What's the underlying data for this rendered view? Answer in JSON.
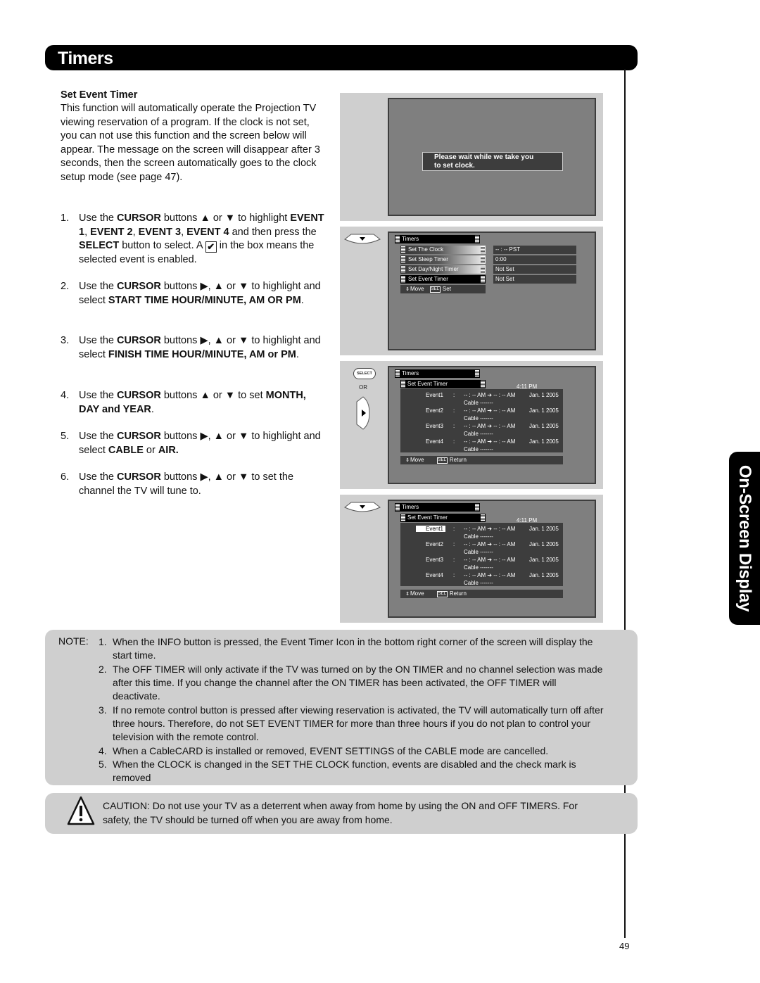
{
  "header": {
    "title": "Timers"
  },
  "side_tab": {
    "label": "On-Screen Display"
  },
  "section": {
    "heading": "Set Event Timer",
    "intro": "This function will automatically operate the Projection TV viewing reservation of a program. If the clock is not set, you can not use this function and the screen below will appear. The message on the screen will disappear after 3 seconds, then the screen automatically goes to the clock setup mode (see page 47)."
  },
  "steps": [
    {
      "num": "1.",
      "parts": [
        {
          "t": "Use the "
        },
        {
          "b": "CURSOR"
        },
        {
          "t": " buttons ▲ or ▼ to highlight "
        },
        {
          "b": "EVENT 1"
        },
        {
          "t": ", "
        },
        {
          "b": "EVENT 2"
        },
        {
          "t": ", "
        },
        {
          "b": "EVENT 3"
        },
        {
          "t": ", "
        },
        {
          "b": "EVENT 4"
        },
        {
          "t": " and then press the "
        },
        {
          "b": "SELECT"
        },
        {
          "t": " button to select.  A "
        },
        {
          "check": "✔"
        },
        {
          "t": " in the box means the selected event is enabled."
        }
      ]
    },
    {
      "num": "2.",
      "parts": [
        {
          "t": "Use the "
        },
        {
          "b": "CURSOR"
        },
        {
          "t": " buttons ▶, ▲ or ▼ to highlight and select "
        },
        {
          "b": "START TIME HOUR/MINUTE, AM OR PM"
        },
        {
          "t": "."
        }
      ]
    },
    {
      "num": "3.",
      "parts": [
        {
          "t": "Use the "
        },
        {
          "b": "CURSOR"
        },
        {
          "t": " buttons ▶, ▲ or ▼ to highlight and select "
        },
        {
          "b": "FINISH TIME HOUR/MINUTE, AM or PM"
        },
        {
          "t": "."
        }
      ]
    },
    {
      "num": "4.",
      "parts": [
        {
          "t": "Use the "
        },
        {
          "b": "CURSOR"
        },
        {
          "t": " buttons ▲ or ▼ to set "
        },
        {
          "b": "MONTH, DAY and YEAR"
        },
        {
          "t": "."
        }
      ]
    },
    {
      "num": "5.",
      "parts": [
        {
          "t": "Use the "
        },
        {
          "b": "CURSOR"
        },
        {
          "t": " buttons ▶, ▲ or ▼ to highlight and select "
        },
        {
          "b": "CABLE"
        },
        {
          "t": " or "
        },
        {
          "b": "AIR."
        }
      ]
    },
    {
      "num": "6.",
      "parts": [
        {
          "t": "Use the "
        },
        {
          "b": "CURSOR"
        },
        {
          "t": " buttons ▶, ▲ or ▼ to set the channel the TV will tune to."
        }
      ]
    }
  ],
  "screen1": {
    "message_line1": "Please wait while we take you",
    "message_line2": "to set clock."
  },
  "screen2": {
    "remote_icon": "cursor-down-button",
    "menu_title": "Timers",
    "items": [
      {
        "label": "Set The Clock",
        "value": "-- : --  PST"
      },
      {
        "label": "Set Sleep Timer",
        "value": "0:00"
      },
      {
        "label": "Set Day/Night Timer",
        "value": "Not Set"
      },
      {
        "label": "Set Event Timer",
        "value": "Not Set"
      }
    ],
    "hint_move": "Move",
    "hint_sel_key": "SEL",
    "hint_set": "Set"
  },
  "screen3": {
    "remote_select": "SELECT",
    "remote_or": "OR",
    "remote_icon": "cursor-right-button",
    "menu_title": "Timers",
    "submenu_title": "Set Event Timer",
    "clock": "4:11 PM",
    "events": [
      {
        "name": "Event1",
        "colon": ":",
        "time": "-- : -- AM  ➔ -- : -- AM",
        "date": "Jan. 1 2005",
        "source": "Cable   -------"
      },
      {
        "name": "Event2",
        "colon": ":",
        "time": "-- : -- AM  ➔ -- : -- AM",
        "date": "Jan. 1 2005",
        "source": "Cable   -------"
      },
      {
        "name": "Event3",
        "colon": ":",
        "time": "-- : -- AM  ➔ -- : -- AM",
        "date": "Jan. 1 2005",
        "source": "Cable   -------"
      },
      {
        "name": "Event4",
        "colon": ":",
        "time": "-- : -- AM  ➔ -- : -- AM",
        "date": "Jan. 1 2005",
        "source": "Cable   -------"
      }
    ],
    "hint_move": "Move",
    "hint_sel_key": "SEL",
    "hint_return": "Return"
  },
  "screen4": {
    "remote_icon": "cursor-down-button",
    "menu_title": "Timers",
    "submenu_title": "Set Event Timer",
    "clock": "4:11 PM",
    "highlighted_event": "Event1",
    "events": [
      {
        "name": "Event1",
        "colon": ":",
        "time": "-- : -- AM  ➔ -- : -- AM",
        "date": "Jan. 1 2005",
        "source": "Cable   -------"
      },
      {
        "name": "Event2",
        "colon": ":",
        "time": "-- : -- AM  ➔ -- : -- AM",
        "date": "Jan. 1 2005",
        "source": "Cable   -------"
      },
      {
        "name": "Event3",
        "colon": ":",
        "time": "-- : -- AM  ➔ -- : -- AM",
        "date": "Jan. 1 2005",
        "source": "Cable   -------"
      },
      {
        "name": "Event4",
        "colon": ":",
        "time": "-- : -- AM  ➔ -- : -- AM",
        "date": "Jan. 1 2005",
        "source": "Cable   -------"
      }
    ],
    "hint_move": "Move",
    "hint_sel_key": "SEL",
    "hint_return": "Return"
  },
  "note": {
    "label": "NOTE:",
    "items": [
      {
        "num": "1.",
        "text": "When the INFO button is pressed, the Event Timer Icon in the bottom right corner of the screen will display the start time."
      },
      {
        "num": "2.",
        "text": "The OFF TIMER will only activate if the TV was turned on by the   ON TIMER and no channel selection was made after this time. If you change the channel after the    ON TIMER has been activated, the  OFF TIMER will deactivate."
      },
      {
        "num": "3.",
        "text": "If no remote control button is pressed after viewing reservation is activated, the TV will automatically turn off after three hours. Therefore, do not    SET EVENT TIMER for more than three hours if you do not plan to control your television with the remote control."
      },
      {
        "num": "4.",
        "text": "When a CableCARD is installed or removed,  EVENT SETTINGS of the CABLE mode are cancelled."
      },
      {
        "num": "5.",
        "text": "When the CLOCK is changed in the  SET THE CLOCK function, events are disabled and the check mark is removed"
      }
    ]
  },
  "caution": {
    "icon": "warning-triangle",
    "text": "CAUTION:  Do not use your TV as a deterrent when away from home by using the    ON and OFF TIMERS. For safety, the TV should be turned off when you are away from home."
  },
  "page_number": "49"
}
